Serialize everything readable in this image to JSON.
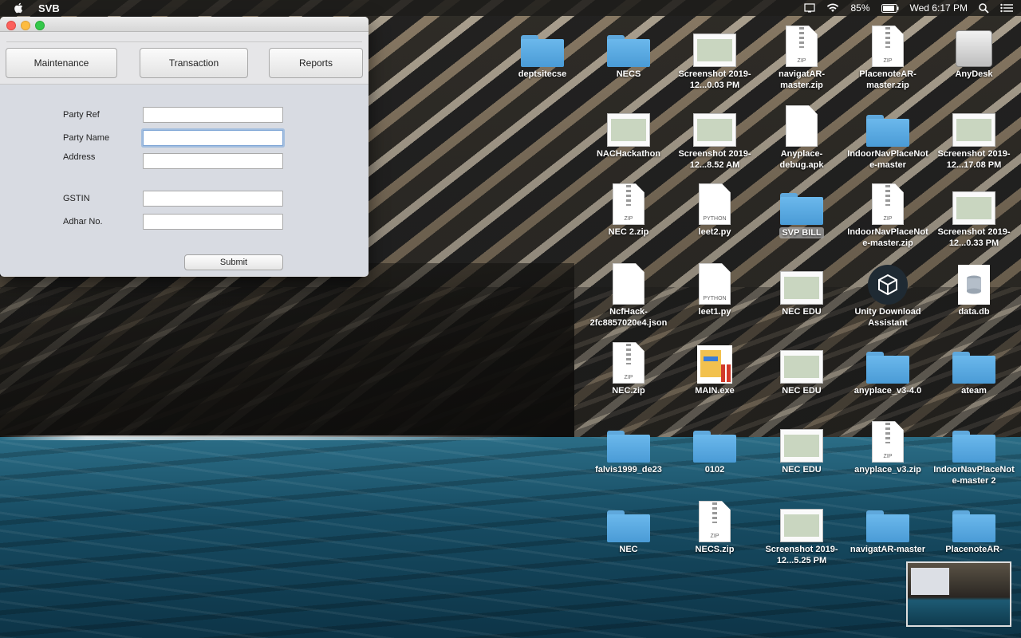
{
  "menubar": {
    "app_name": "SVB",
    "battery_percent": "85%",
    "clock": "Wed 6:17 PM"
  },
  "window": {
    "tabs": [
      {
        "label": "Maintenance"
      },
      {
        "label": "Transaction"
      },
      {
        "label": "Reports"
      }
    ],
    "form": {
      "party_ref_label": "Party Ref",
      "party_name_label": "Party Name",
      "address_label": "Address",
      "gstin_label": "GSTIN",
      "adhar_label": "Adhar No.",
      "party_ref_value": "",
      "party_name_value": "",
      "address_value": "",
      "gstin_value": "",
      "adhar_value": "",
      "submit_label": "Submit"
    }
  },
  "desktop": {
    "icons": [
      {
        "label": "deptsitecse",
        "type": "folder"
      },
      {
        "label": "NECS",
        "type": "folder"
      },
      {
        "label": "Screenshot 2019-12...0.03 PM",
        "type": "screenshot"
      },
      {
        "label": "navigatAR-master.zip",
        "type": "zip"
      },
      {
        "label": "PlacenoteAR-master.zip",
        "type": "zip"
      },
      {
        "label": "AnyDesk",
        "type": "disk"
      },
      {
        "label": "NACHackathon",
        "type": "screenshot"
      },
      {
        "label": "Screenshot 2019-12...8.52 AM",
        "type": "screenshot"
      },
      {
        "label": "Anyplace-debug.apk",
        "type": "document"
      },
      {
        "label": "IndoorNavPlaceNote-master",
        "type": "folder"
      },
      {
        "label": "Screenshot 2019-12...17.08 PM",
        "type": "screenshot"
      },
      {
        "label": "NEC 2.zip",
        "type": "zip"
      },
      {
        "label": "leet2.py",
        "type": "python"
      },
      {
        "label": "SVP BILL",
        "type": "folder"
      },
      {
        "label": "IndoorNavPlaceNote-master.zip",
        "type": "zip"
      },
      {
        "label": "Screenshot 2019-12...0.33 PM",
        "type": "screenshot"
      },
      {
        "label": "NcfHack-2fc8857020e4.json",
        "type": "document"
      },
      {
        "label": "leet1.py",
        "type": "python"
      },
      {
        "label": "NEC EDU",
        "type": "screenshot"
      },
      {
        "label": "Unity Download Assistant",
        "type": "unity"
      },
      {
        "label": "data.db",
        "type": "database"
      },
      {
        "label": "NEC.zip",
        "type": "zip"
      },
      {
        "label": "MAIN.exe",
        "type": "exe"
      },
      {
        "label": "NEC EDU",
        "type": "screenshot"
      },
      {
        "label": "anyplace_v3-4.0",
        "type": "folder"
      },
      {
        "label": "ateam",
        "type": "folder"
      },
      {
        "label": "falvis1999_de23",
        "type": "folder"
      },
      {
        "label": "0102",
        "type": "folder"
      },
      {
        "label": "NEC EDU",
        "type": "screenshot"
      },
      {
        "label": "anyplace_v3.zip",
        "type": "zip"
      },
      {
        "label": "IndoorNavPlaceNote-master 2",
        "type": "folder"
      },
      {
        "label": "NEC",
        "type": "folder"
      },
      {
        "label": "NECS.zip",
        "type": "zip"
      },
      {
        "label": "Screenshot 2019-12...5.25 PM",
        "type": "screenshot"
      },
      {
        "label": "navigatAR-master",
        "type": "folder"
      },
      {
        "label": "PlacenoteAR-",
        "type": "folder"
      }
    ],
    "zip_tag": "ZIP",
    "python_tag": "PYTHON"
  },
  "colors": {
    "folder_blue": "#5aaee5",
    "menubar_bg": "#1e1c1a",
    "focus_ring": "#7fa6d6"
  }
}
